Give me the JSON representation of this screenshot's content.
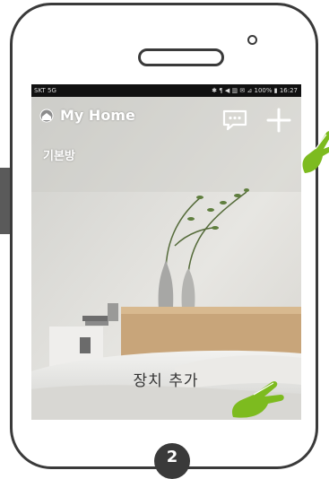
{
  "status_bar": {
    "left": "SKT 5G",
    "right": "✱ ¶ ◀ ▥ ✉ ⊿ 100% ▮ 16:27"
  },
  "header": {
    "title": "My Home",
    "room": "기본방",
    "icons": [
      "home-icon",
      "chat-icon",
      "plus-icon"
    ]
  },
  "main": {
    "add_device_label": "장치 추가"
  },
  "guide": {
    "step": "2"
  },
  "colors": {
    "frame": "#3a3a3a",
    "hand": "#7dbb1f",
    "text_on_image": "#ffffff"
  }
}
